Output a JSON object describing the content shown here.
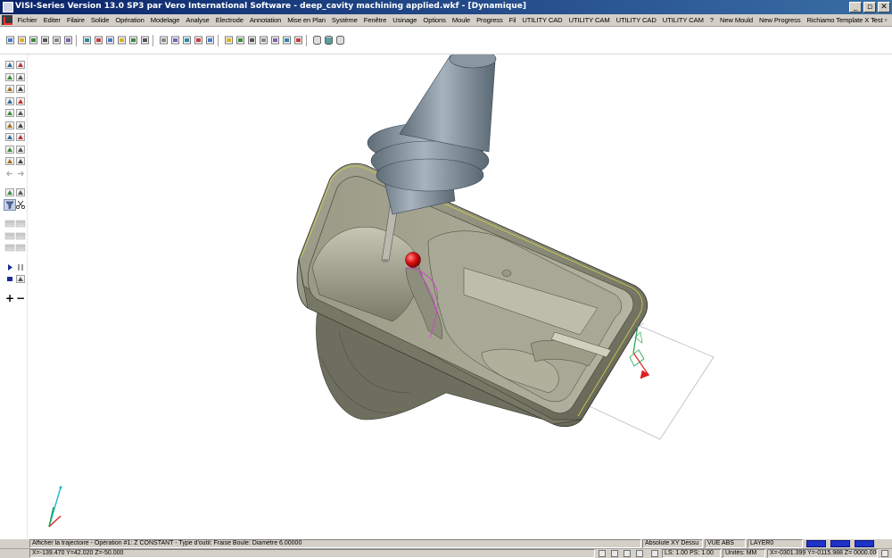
{
  "window": {
    "title": "VISI-Series Version 13.0 SP3 par Vero International Software - deep_cavity machining applied.wkf - [Dynamique]",
    "buttons": {
      "minimize": "_",
      "restore": "▫",
      "close": "✕"
    }
  },
  "menu": {
    "items": [
      "Fichier",
      "Editer",
      "Filaire",
      "Solide",
      "Opération",
      "Modelage",
      "Analyse",
      "Electrode",
      "Annotation",
      "Mise en Plan",
      "Système",
      "Fenêtre",
      "Usinage",
      "Options",
      "Moule",
      "Progress",
      "Fil",
      "UTILITY CAD",
      "UTILITY CAM",
      "UTILITY CAD",
      "UTILITY CAM",
      "?",
      "New Mould",
      "New Progress",
      "Richiamo Template X Test"
    ],
    "mdi_minimize": "–",
    "mdi_restore": "▫"
  },
  "toolbar": {
    "icons": [
      "new-file-icon",
      "open-folder-icon",
      "open-file-icon",
      "save-icon",
      "save-as-icon",
      "print-icon",
      "cut-icon",
      "copy-icon",
      "paste-icon",
      "undo-icon",
      "redo-icon",
      "delete-icon",
      "layers-icon",
      "zoom-window-icon",
      "zoom-all-icon",
      "pan-icon",
      "rotate-icon",
      "view-front-icon",
      "view-top-icon",
      "view-iso-icon",
      "wireframe-icon",
      "shaded-icon",
      "hidden-line-icon",
      "render-icon",
      "cylinder-icon",
      "cylinder-shaded-icon",
      "cylinder-grid-icon"
    ]
  },
  "palette": {
    "rows": [
      [
        "tool-move-icon",
        "tool-measure-icon"
      ],
      [
        "tool-drag-icon",
        "tool-cross-icon"
      ],
      [
        "tool-trim-icon",
        "tool-frame-icon"
      ],
      [
        "tool-shape-icon",
        "tool-diamond-icon"
      ],
      [
        "tool-grid-icon",
        "tool-box-icon"
      ],
      [
        "tool-gear-icon",
        "tool-corner-icon"
      ],
      [
        "tool-pin-icon",
        "tool-bracket-icon"
      ],
      [
        "tool-shield-icon",
        "tool-arrow-icon"
      ],
      [
        "tool-stack-icon",
        "tool-copy-icon"
      ],
      [
        "arrow-left-icon",
        "arrow-right-icon"
      ],
      [
        "tool-wire-icon",
        "tool-book-icon"
      ],
      [
        "filter-icon",
        "scissors-icon"
      ],
      [
        "layer-a-icon",
        "layer-b-icon"
      ],
      [
        "layer-c-icon",
        "layer-d-icon"
      ],
      [
        "layer-e-icon",
        "layer-f-icon"
      ],
      [
        "play-icon",
        "pause-icon"
      ],
      [
        "stop-icon",
        "step-icon"
      ],
      [
        "zoom-in-icon",
        "zoom-out-icon"
      ]
    ],
    "zoom_in": "+",
    "zoom_out": "−"
  },
  "status": {
    "message": "Afficher la trajectoire - Opération #1: Z CONSTANT - Type d'outil: Fraise Boule: Diamètre 6.00000",
    "coords": "X=-139.470 Y=42.020 Z=-50.000",
    "view_mode": "Absolute XY Dessu",
    "view_name": "VUE ABS",
    "layer": "LAYER0",
    "ls_ps": "LS: 1.00 PS: 1.00",
    "units": "Unités: MM",
    "cursor": "X=-0301.399 Y=-0115.988 Z= 0000.000"
  },
  "colors": {
    "titlebar": "#0a246a",
    "chrome": "#d4d0c8",
    "indicator_blue": "#1e32c8",
    "part_body": "#8a8a78",
    "tool_holder": "#7e8c98",
    "ball_marker": "#dd1111"
  }
}
